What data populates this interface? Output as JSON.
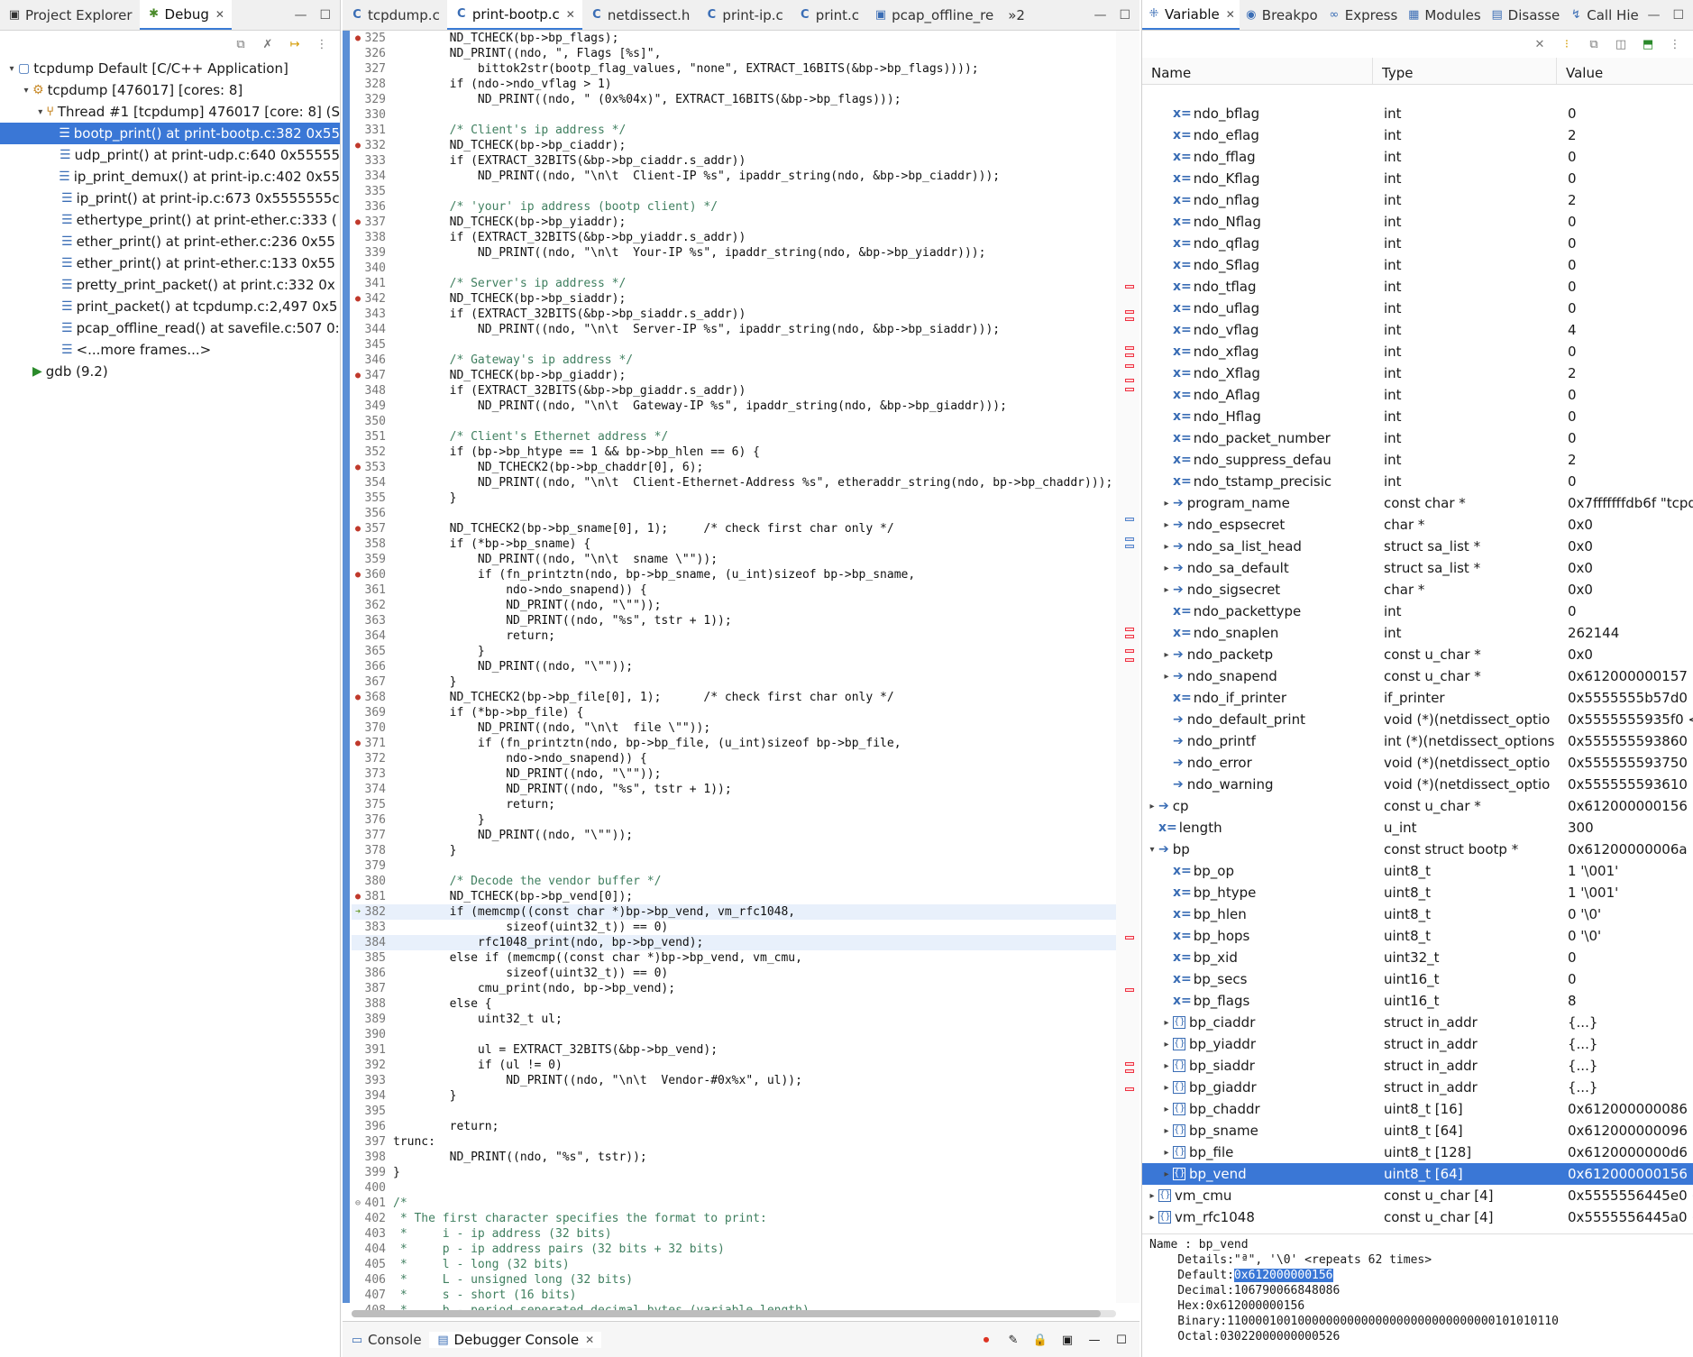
{
  "left_tabs": [
    {
      "label": "Project Explorer",
      "icon": "project-explorer-icon"
    },
    {
      "label": "Debug",
      "icon": "debug-bug-icon",
      "active": true
    }
  ],
  "debug_tree": [
    {
      "indent": 0,
      "tw": "▾",
      "icon": "c-app-icon",
      "label": "tcpdump Default [C/C++ Application]"
    },
    {
      "indent": 1,
      "tw": "▾",
      "icon": "process-icon",
      "label": "tcpdump [476017] [cores: 8]"
    },
    {
      "indent": 2,
      "tw": "▾",
      "icon": "thread-icon",
      "label": "Thread #1 [tcpdump] 476017 [core: 8] (S"
    },
    {
      "indent": 3,
      "tw": "",
      "icon": "stack",
      "label": "bootp_print() at print-bootp.c:382 0x55",
      "sel": true
    },
    {
      "indent": 3,
      "tw": "",
      "icon": "stack",
      "label": "udp_print() at print-udp.c:640 0x55555"
    },
    {
      "indent": 3,
      "tw": "",
      "icon": "stack",
      "label": "ip_print_demux() at print-ip.c:402 0x55"
    },
    {
      "indent": 3,
      "tw": "",
      "icon": "stack",
      "label": "ip_print() at print-ip.c:673 0x5555555c"
    },
    {
      "indent": 3,
      "tw": "",
      "icon": "stack",
      "label": "ethertype_print() at print-ether.c:333 ("
    },
    {
      "indent": 3,
      "tw": "",
      "icon": "stack",
      "label": "ether_print() at print-ether.c:236 0x55"
    },
    {
      "indent": 3,
      "tw": "",
      "icon": "stack",
      "label": "ether_print() at print-ether.c:133 0x55"
    },
    {
      "indent": 3,
      "tw": "",
      "icon": "stack",
      "label": "pretty_print_packet() at print.c:332 0x"
    },
    {
      "indent": 3,
      "tw": "",
      "icon": "stack",
      "label": "print_packet() at tcpdump.c:2,497 0x5"
    },
    {
      "indent": 3,
      "tw": "",
      "icon": "stack",
      "label": "pcap_offline_read() at savefile.c:507 0:"
    },
    {
      "indent": 3,
      "tw": "",
      "icon": "stack",
      "label": "<...more frames...>"
    },
    {
      "indent": 1,
      "tw": "",
      "icon": "gdb-icon",
      "label": "gdb (9.2)"
    }
  ],
  "editor_tabs": [
    {
      "label": "tcpdump.c"
    },
    {
      "label": "print-bootp.c",
      "active": true
    },
    {
      "label": "netdissect.h"
    },
    {
      "label": "print-ip.c"
    },
    {
      "label": "print.c"
    },
    {
      "label": "pcap_offline_re"
    },
    {
      "label": "»2"
    }
  ],
  "code_lines": [
    {
      "n": "325",
      "m": "bp",
      "t": "        ND_TCHECK(bp->bp_flags);"
    },
    {
      "n": "326",
      "t": "        ND_PRINT((ndo, \", Flags [%s]\","
    },
    {
      "n": "327",
      "t": "            bittok2str(bootp_flag_values, \"none\", EXTRACT_16BITS(&bp->bp_flags))));"
    },
    {
      "n": "328",
      "t": "        if (ndo->ndo_vflag > 1)"
    },
    {
      "n": "329",
      "t": "            ND_PRINT((ndo, \" (0x%04x)\", EXTRACT_16BITS(&bp->bp_flags)));"
    },
    {
      "n": "330",
      "t": ""
    },
    {
      "n": "331",
      "t": "        /* Client's ip address */"
    },
    {
      "n": "332",
      "m": "bp",
      "t": "        ND_TCHECK(bp->bp_ciaddr);"
    },
    {
      "n": "333",
      "t": "        if (EXTRACT_32BITS(&bp->bp_ciaddr.s_addr))"
    },
    {
      "n": "334",
      "t": "            ND_PRINT((ndo, \"\\n\\t  Client-IP %s\", ipaddr_string(ndo, &bp->bp_ciaddr)));"
    },
    {
      "n": "335",
      "t": ""
    },
    {
      "n": "336",
      "t": "        /* 'your' ip address (bootp client) */"
    },
    {
      "n": "337",
      "m": "bp",
      "t": "        ND_TCHECK(bp->bp_yiaddr);"
    },
    {
      "n": "338",
      "t": "        if (EXTRACT_32BITS(&bp->bp_yiaddr.s_addr))"
    },
    {
      "n": "339",
      "t": "            ND_PRINT((ndo, \"\\n\\t  Your-IP %s\", ipaddr_string(ndo, &bp->bp_yiaddr)));"
    },
    {
      "n": "340",
      "t": ""
    },
    {
      "n": "341",
      "t": "        /* Server's ip address */"
    },
    {
      "n": "342",
      "m": "bp",
      "t": "        ND_TCHECK(bp->bp_siaddr);"
    },
    {
      "n": "343",
      "t": "        if (EXTRACT_32BITS(&bp->bp_siaddr.s_addr))"
    },
    {
      "n": "344",
      "t": "            ND_PRINT((ndo, \"\\n\\t  Server-IP %s\", ipaddr_string(ndo, &bp->bp_siaddr)));"
    },
    {
      "n": "345",
      "t": ""
    },
    {
      "n": "346",
      "t": "        /* Gateway's ip address */"
    },
    {
      "n": "347",
      "m": "bp",
      "t": "        ND_TCHECK(bp->bp_giaddr);"
    },
    {
      "n": "348",
      "t": "        if (EXTRACT_32BITS(&bp->bp_giaddr.s_addr))"
    },
    {
      "n": "349",
      "t": "            ND_PRINT((ndo, \"\\n\\t  Gateway-IP %s\", ipaddr_string(ndo, &bp->bp_giaddr)));"
    },
    {
      "n": "350",
      "t": ""
    },
    {
      "n": "351",
      "t": "        /* Client's Ethernet address */"
    },
    {
      "n": "352",
      "t": "        if (bp->bp_htype == 1 && bp->bp_hlen == 6) {"
    },
    {
      "n": "353",
      "m": "bp",
      "t": "            ND_TCHECK2(bp->bp_chaddr[0], 6);"
    },
    {
      "n": "354",
      "t": "            ND_PRINT((ndo, \"\\n\\t  Client-Ethernet-Address %s\", etheraddr_string(ndo, bp->bp_chaddr)));"
    },
    {
      "n": "355",
      "t": "        }"
    },
    {
      "n": "356",
      "t": ""
    },
    {
      "n": "357",
      "m": "bp",
      "t": "        ND_TCHECK2(bp->bp_sname[0], 1);     /* check first char only */"
    },
    {
      "n": "358",
      "t": "        if (*bp->bp_sname) {"
    },
    {
      "n": "359",
      "t": "            ND_PRINT((ndo, \"\\n\\t  sname \\\"\"));"
    },
    {
      "n": "360",
      "m": "bp",
      "t": "            if (fn_printztn(ndo, bp->bp_sname, (u_int)sizeof bp->bp_sname,"
    },
    {
      "n": "361",
      "t": "                ndo->ndo_snapend)) {"
    },
    {
      "n": "362",
      "t": "                ND_PRINT((ndo, \"\\\"\"));"
    },
    {
      "n": "363",
      "t": "                ND_PRINT((ndo, \"%s\", tstr + 1));"
    },
    {
      "n": "364",
      "t": "                return;"
    },
    {
      "n": "365",
      "t": "            }"
    },
    {
      "n": "366",
      "t": "            ND_PRINT((ndo, \"\\\"\"));"
    },
    {
      "n": "367",
      "t": "        }"
    },
    {
      "n": "368",
      "m": "bp",
      "t": "        ND_TCHECK2(bp->bp_file[0], 1);      /* check first char only */"
    },
    {
      "n": "369",
      "t": "        if (*bp->bp_file) {"
    },
    {
      "n": "370",
      "t": "            ND_PRINT((ndo, \"\\n\\t  file \\\"\"));"
    },
    {
      "n": "371",
      "m": "bp",
      "t": "            if (fn_printztn(ndo, bp->bp_file, (u_int)sizeof bp->bp_file,"
    },
    {
      "n": "372",
      "t": "                ndo->ndo_snapend)) {"
    },
    {
      "n": "373",
      "t": "                ND_PRINT((ndo, \"\\\"\"));"
    },
    {
      "n": "374",
      "t": "                ND_PRINT((ndo, \"%s\", tstr + 1));"
    },
    {
      "n": "375",
      "t": "                return;"
    },
    {
      "n": "376",
      "t": "            }"
    },
    {
      "n": "377",
      "t": "            ND_PRINT((ndo, \"\\\"\"));"
    },
    {
      "n": "378",
      "t": "        }"
    },
    {
      "n": "379",
      "t": ""
    },
    {
      "n": "380",
      "t": "        /* Decode the vendor buffer */"
    },
    {
      "n": "381",
      "m": "bp",
      "t": "        ND_TCHECK(bp->bp_vend[0]);"
    },
    {
      "n": "382",
      "m": "ip",
      "t": "        if (memcmp((const char *)bp->bp_vend, vm_rfc1048,",
      "cur": true
    },
    {
      "n": "383",
      "t": "                sizeof(uint32_t)) == 0)"
    },
    {
      "n": "384",
      "t": "            rfc1048_print(ndo, bp->bp_vend);",
      "cur": true
    },
    {
      "n": "385",
      "t": "        else if (memcmp((const char *)bp->bp_vend, vm_cmu,"
    },
    {
      "n": "386",
      "t": "                sizeof(uint32_t)) == 0)"
    },
    {
      "n": "387",
      "t": "            cmu_print(ndo, bp->bp_vend);"
    },
    {
      "n": "388",
      "t": "        else {"
    },
    {
      "n": "389",
      "t": "            uint32_t ul;"
    },
    {
      "n": "390",
      "t": ""
    },
    {
      "n": "391",
      "t": "            ul = EXTRACT_32BITS(&bp->bp_vend);"
    },
    {
      "n": "392",
      "t": "            if (ul != 0)"
    },
    {
      "n": "393",
      "t": "                ND_PRINT((ndo, \"\\n\\t  Vendor-#0x%x\", ul));"
    },
    {
      "n": "394",
      "t": "        }"
    },
    {
      "n": "395",
      "t": ""
    },
    {
      "n": "396",
      "t": "        return;"
    },
    {
      "n": "397",
      "t": "trunc:"
    },
    {
      "n": "398",
      "t": "        ND_PRINT((ndo, \"%s\", tstr));"
    },
    {
      "n": "399",
      "t": "}"
    },
    {
      "n": "400",
      "t": ""
    },
    {
      "n": "401",
      "m": "fold",
      "t": "/*"
    },
    {
      "n": "402",
      "t": " * The first character specifies the format to print:"
    },
    {
      "n": "403",
      "t": " *     i - ip address (32 bits)"
    },
    {
      "n": "404",
      "t": " *     p - ip address pairs (32 bits + 32 bits)"
    },
    {
      "n": "405",
      "t": " *     l - long (32 bits)"
    },
    {
      "n": "406",
      "t": " *     L - unsigned long (32 bits)"
    },
    {
      "n": "407",
      "t": " *     s - short (16 bits)"
    },
    {
      "n": "408",
      "t": " *     b - period-seperated decimal bytes (variable length)"
    }
  ],
  "bottom_tabs": [
    {
      "label": "Console",
      "icon": "console-icon"
    },
    {
      "label": "Debugger Console",
      "icon": "debugger-console-icon",
      "active": true
    }
  ],
  "right_tabs": [
    {
      "label": "Variable",
      "icon": "variables-icon",
      "active": true
    },
    {
      "label": "Breakpo",
      "icon": "breakpoints-icon"
    },
    {
      "label": "Express",
      "icon": "expressions-icon"
    },
    {
      "label": "Modules",
      "icon": "modules-icon"
    },
    {
      "label": "Disasse",
      "icon": "disassembly-icon"
    },
    {
      "label": "Call Hie",
      "icon": "call-hierarchy-icon"
    }
  ],
  "var_columns": [
    "Name",
    "Type",
    "Value"
  ],
  "var_rows": [
    {
      "ind": 1,
      "tw": "",
      "k": "x",
      "name": "ndo_bflag",
      "type": "int",
      "value": "0"
    },
    {
      "ind": 1,
      "tw": "",
      "k": "x",
      "name": "ndo_eflag",
      "type": "int",
      "value": "2"
    },
    {
      "ind": 1,
      "tw": "",
      "k": "x",
      "name": "ndo_fflag",
      "type": "int",
      "value": "0"
    },
    {
      "ind": 1,
      "tw": "",
      "k": "x",
      "name": "ndo_Kflag",
      "type": "int",
      "value": "0"
    },
    {
      "ind": 1,
      "tw": "",
      "k": "x",
      "name": "ndo_nflag",
      "type": "int",
      "value": "2"
    },
    {
      "ind": 1,
      "tw": "",
      "k": "x",
      "name": "ndo_Nflag",
      "type": "int",
      "value": "0"
    },
    {
      "ind": 1,
      "tw": "",
      "k": "x",
      "name": "ndo_qflag",
      "type": "int",
      "value": "0"
    },
    {
      "ind": 1,
      "tw": "",
      "k": "x",
      "name": "ndo_Sflag",
      "type": "int",
      "value": "0"
    },
    {
      "ind": 1,
      "tw": "",
      "k": "x",
      "name": "ndo_tflag",
      "type": "int",
      "value": "0"
    },
    {
      "ind": 1,
      "tw": "",
      "k": "x",
      "name": "ndo_uflag",
      "type": "int",
      "value": "0"
    },
    {
      "ind": 1,
      "tw": "",
      "k": "x",
      "name": "ndo_vflag",
      "type": "int",
      "value": "4"
    },
    {
      "ind": 1,
      "tw": "",
      "k": "x",
      "name": "ndo_xflag",
      "type": "int",
      "value": "0"
    },
    {
      "ind": 1,
      "tw": "",
      "k": "x",
      "name": "ndo_Xflag",
      "type": "int",
      "value": "2"
    },
    {
      "ind": 1,
      "tw": "",
      "k": "x",
      "name": "ndo_Aflag",
      "type": "int",
      "value": "0"
    },
    {
      "ind": 1,
      "tw": "",
      "k": "x",
      "name": "ndo_Hflag",
      "type": "int",
      "value": "0"
    },
    {
      "ind": 1,
      "tw": "",
      "k": "x",
      "name": "ndo_packet_number",
      "type": "int",
      "value": "0"
    },
    {
      "ind": 1,
      "tw": "",
      "k": "x",
      "name": "ndo_suppress_defau",
      "type": "int",
      "value": "2"
    },
    {
      "ind": 1,
      "tw": "",
      "k": "x",
      "name": "ndo_tstamp_precisic",
      "type": "int",
      "value": "0"
    },
    {
      "ind": 1,
      "tw": "▸",
      "k": "a",
      "name": "program_name",
      "type": "const char *",
      "value": "0x7fffffffdb6f \"tcpdump\""
    },
    {
      "ind": 1,
      "tw": "▸",
      "k": "a",
      "name": "ndo_espsecret",
      "type": "char *",
      "value": "0x0"
    },
    {
      "ind": 1,
      "tw": "▸",
      "k": "a",
      "name": "ndo_sa_list_head",
      "type": "struct sa_list *",
      "value": "0x0"
    },
    {
      "ind": 1,
      "tw": "▸",
      "k": "a",
      "name": "ndo_sa_default",
      "type": "struct sa_list *",
      "value": "0x0"
    },
    {
      "ind": 1,
      "tw": "▸",
      "k": "a",
      "name": "ndo_sigsecret",
      "type": "char *",
      "value": "0x0"
    },
    {
      "ind": 1,
      "tw": "",
      "k": "x",
      "name": "ndo_packettype",
      "type": "int",
      "value": "0"
    },
    {
      "ind": 1,
      "tw": "",
      "k": "x",
      "name": "ndo_snaplen",
      "type": "int",
      "value": "262144"
    },
    {
      "ind": 1,
      "tw": "▸",
      "k": "a",
      "name": "ndo_packetp",
      "type": "const u_char *",
      "value": "0x0"
    },
    {
      "ind": 1,
      "tw": "▸",
      "k": "a",
      "name": "ndo_snapend",
      "type": "const u_char *",
      "value": "0x612000000157 \"\""
    },
    {
      "ind": 1,
      "tw": "",
      "k": "x",
      "name": "ndo_if_printer",
      "type": "if_printer",
      "value": "0x5555555b57d0 <ether"
    },
    {
      "ind": 1,
      "tw": "",
      "k": "a",
      "name": "ndo_default_print",
      "type": "void (*)(netdissect_optio",
      "value": "0x5555555935f0 <ndo_d"
    },
    {
      "ind": 1,
      "tw": "",
      "k": "a",
      "name": "ndo_printf",
      "type": "int (*)(netdissect_options",
      "value": "0x555555593860 <ndo_p"
    },
    {
      "ind": 1,
      "tw": "",
      "k": "a",
      "name": "ndo_error",
      "type": "void (*)(netdissect_optio",
      "value": "0x555555593750 <ndo_e"
    },
    {
      "ind": 1,
      "tw": "",
      "k": "a",
      "name": "ndo_warning",
      "type": "void (*)(netdissect_optio",
      "value": "0x555555593610 <ndo_w"
    },
    {
      "ind": 0,
      "tw": "▸",
      "k": "a",
      "name": "cp",
      "type": "const u_char *",
      "value": "0x612000000156 \"ª\""
    },
    {
      "ind": 0,
      "tw": "",
      "k": "x",
      "name": "length",
      "type": "u_int",
      "value": "300"
    },
    {
      "ind": 0,
      "tw": "▾",
      "k": "a",
      "name": "bp",
      "type": "const struct bootp *",
      "value": "0x61200000006a"
    },
    {
      "ind": 1,
      "tw": "",
      "k": "x",
      "name": "bp_op",
      "type": "uint8_t",
      "value": "1 '\\001'"
    },
    {
      "ind": 1,
      "tw": "",
      "k": "x",
      "name": "bp_htype",
      "type": "uint8_t",
      "value": "1 '\\001'"
    },
    {
      "ind": 1,
      "tw": "",
      "k": "x",
      "name": "bp_hlen",
      "type": "uint8_t",
      "value": "0 '\\0'"
    },
    {
      "ind": 1,
      "tw": "",
      "k": "x",
      "name": "bp_hops",
      "type": "uint8_t",
      "value": "0 '\\0'"
    },
    {
      "ind": 1,
      "tw": "",
      "k": "x",
      "name": "bp_xid",
      "type": "uint32_t",
      "value": "0"
    },
    {
      "ind": 1,
      "tw": "",
      "k": "x",
      "name": "bp_secs",
      "type": "uint16_t",
      "value": "0"
    },
    {
      "ind": 1,
      "tw": "",
      "k": "x",
      "name": "bp_flags",
      "type": "uint16_t",
      "value": "8"
    },
    {
      "ind": 1,
      "tw": "▸",
      "k": "s",
      "name": "bp_ciaddr",
      "type": "struct in_addr",
      "value": "{...}"
    },
    {
      "ind": 1,
      "tw": "▸",
      "k": "s",
      "name": "bp_yiaddr",
      "type": "struct in_addr",
      "value": "{...}"
    },
    {
      "ind": 1,
      "tw": "▸",
      "k": "s",
      "name": "bp_siaddr",
      "type": "struct in_addr",
      "value": "{...}"
    },
    {
      "ind": 1,
      "tw": "▸",
      "k": "s",
      "name": "bp_giaddr",
      "type": "struct in_addr",
      "value": "{...}"
    },
    {
      "ind": 1,
      "tw": "▸",
      "k": "s",
      "name": "bp_chaddr",
      "type": "uint8_t [16]",
      "value": "0x612000000086"
    },
    {
      "ind": 1,
      "tw": "▸",
      "k": "s",
      "name": "bp_sname",
      "type": "uint8_t [64]",
      "value": "0x612000000096"
    },
    {
      "ind": 1,
      "tw": "▸",
      "k": "s",
      "name": "bp_file",
      "type": "uint8_t [128]",
      "value": "0x6120000000d6"
    },
    {
      "ind": 1,
      "tw": "▸",
      "k": "s",
      "name": "bp_vend",
      "type": "uint8_t [64]",
      "value": "0x612000000156",
      "sel": true
    },
    {
      "ind": 0,
      "tw": "▸",
      "k": "s",
      "name": "vm_cmu",
      "type": "const u_char [4]",
      "value": "0x5555556445e0 <vm_c"
    },
    {
      "ind": 0,
      "tw": "▸",
      "k": "s",
      "name": "vm_rfc1048",
      "type": "const u_char [4]",
      "value": "0x5555556445a0 <vm_r"
    }
  ],
  "details": {
    "name": "Name : bp_vend",
    "details": "    Details:\"ª\", '\\0' <repeats 62 times>",
    "default_label": "    Default:",
    "default_value": "0x612000000156",
    "decimal": "    Decimal:106790066848086",
    "hex": "    Hex:0x612000000156",
    "binary": "    Binary:11000010010000000000000000000000000000101010110",
    "octal": "    Octal:03022000000000526"
  },
  "colors": {
    "accent": "#3a77d6",
    "breakpoint": "#c0392b"
  }
}
